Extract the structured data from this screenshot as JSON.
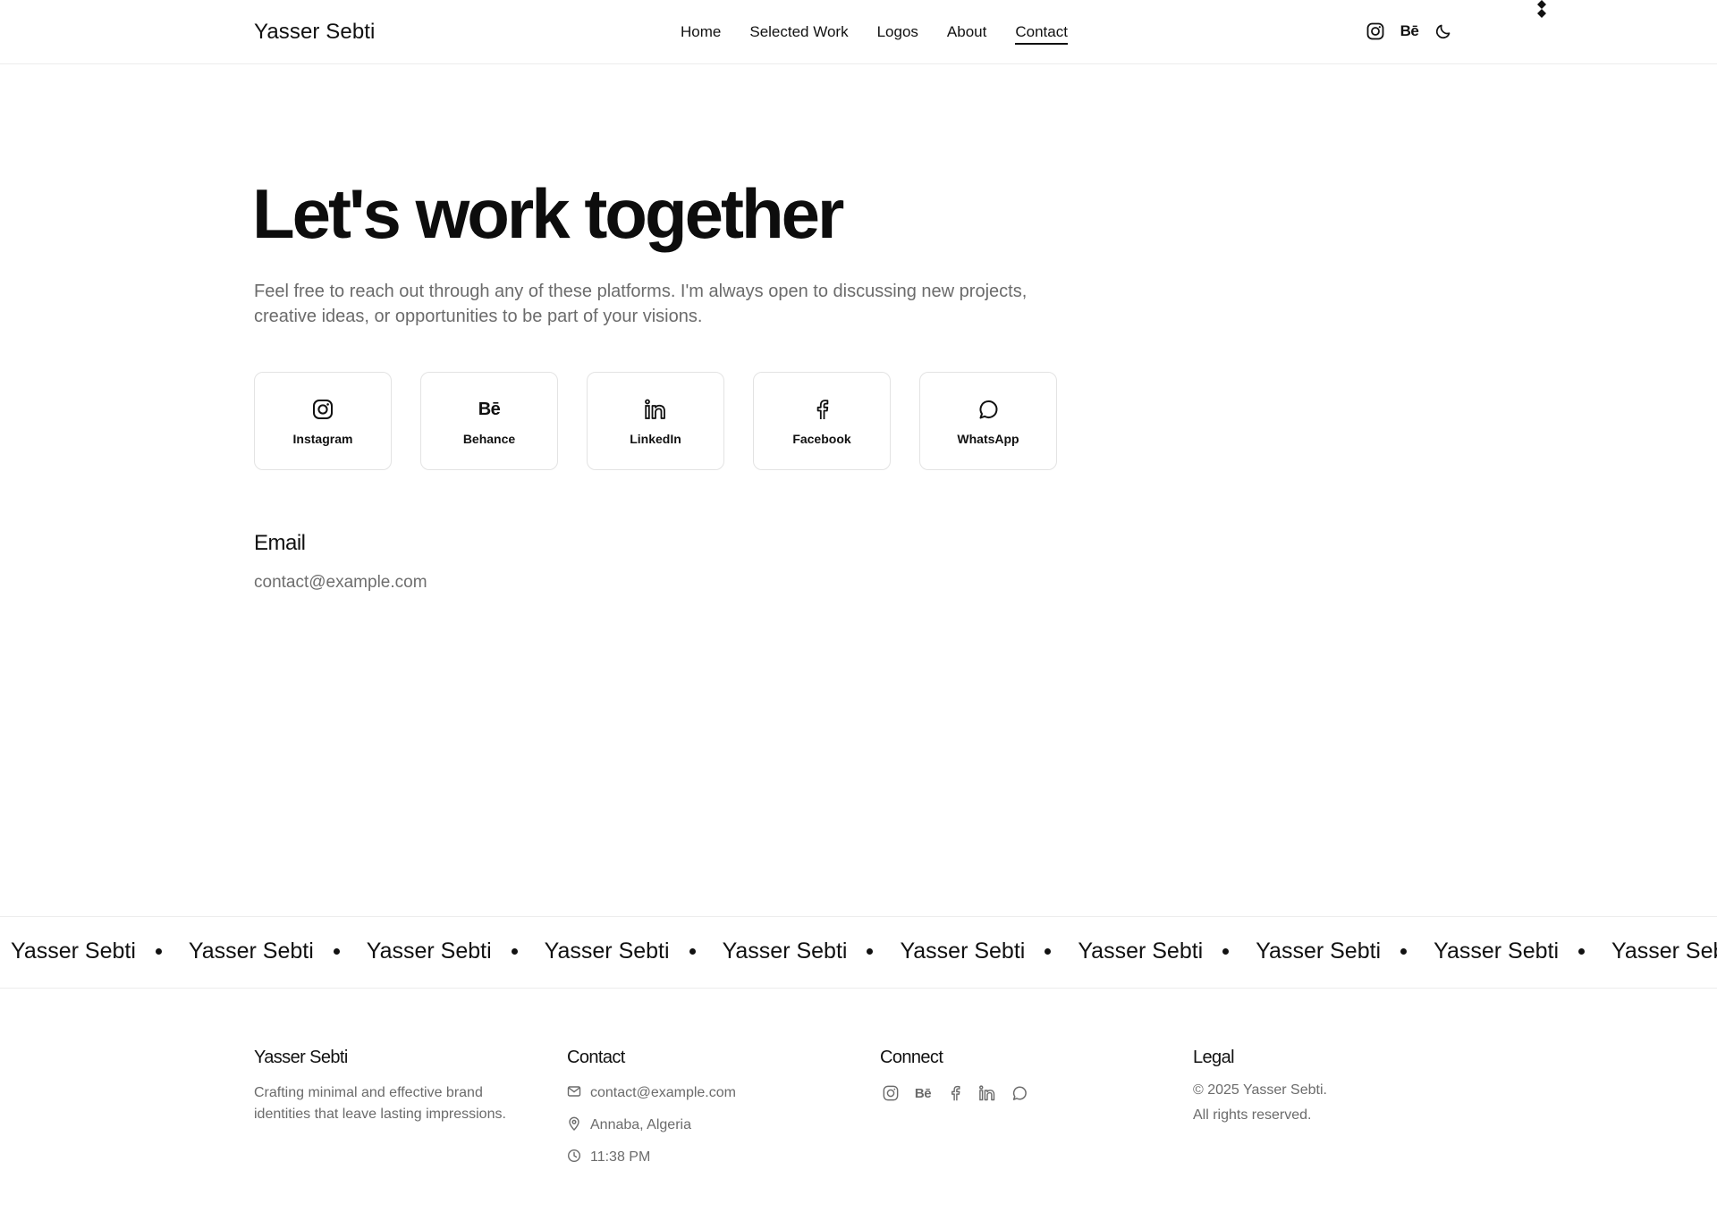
{
  "header": {
    "brand": "Yasser Sebti",
    "nav": [
      "Home",
      "Selected Work",
      "Logos",
      "About",
      "Contact"
    ],
    "active_nav": "Contact",
    "icons": [
      "instagram-icon",
      "behance-icon",
      "moon-icon"
    ],
    "behance_glyph": "Bē"
  },
  "hero": {
    "title": "Let's work together",
    "subtitle": "Feel free to reach out through any of these platforms. I'm always open to discussing new projects, creative ideas, or opportunities to be part of your visions."
  },
  "platforms": [
    {
      "label": "Instagram",
      "icon": "instagram-icon"
    },
    {
      "label": "Behance",
      "icon": "behance-icon"
    },
    {
      "label": "LinkedIn",
      "icon": "linkedin-icon"
    },
    {
      "label": "Facebook",
      "icon": "facebook-icon"
    },
    {
      "label": "WhatsApp",
      "icon": "whatsapp-icon"
    }
  ],
  "email": {
    "heading": "Email",
    "address": "contact@example.com"
  },
  "marquee": {
    "text": "Yasser Sebti",
    "repeat": 10
  },
  "footer": {
    "about": {
      "title": "Yasser Sebti",
      "text": "Crafting minimal and effective brand identities that leave lasting impressions."
    },
    "contact": {
      "title": "Contact",
      "email": "contact@example.com",
      "location": "Annaba, Algeria",
      "time": "11:38 PM"
    },
    "connect": {
      "title": "Connect",
      "icons": [
        "instagram-icon",
        "behance-icon",
        "facebook-icon",
        "linkedin-icon",
        "whatsapp-icon"
      ]
    },
    "legal": {
      "title": "Legal",
      "copyright": "© 2025 Yasser Sebti.",
      "rights": "All rights reserved."
    }
  },
  "colors": {
    "text": "#111111",
    "muted": "#6b6b6b",
    "border": "#e3e3e3",
    "background": "#ffffff"
  }
}
